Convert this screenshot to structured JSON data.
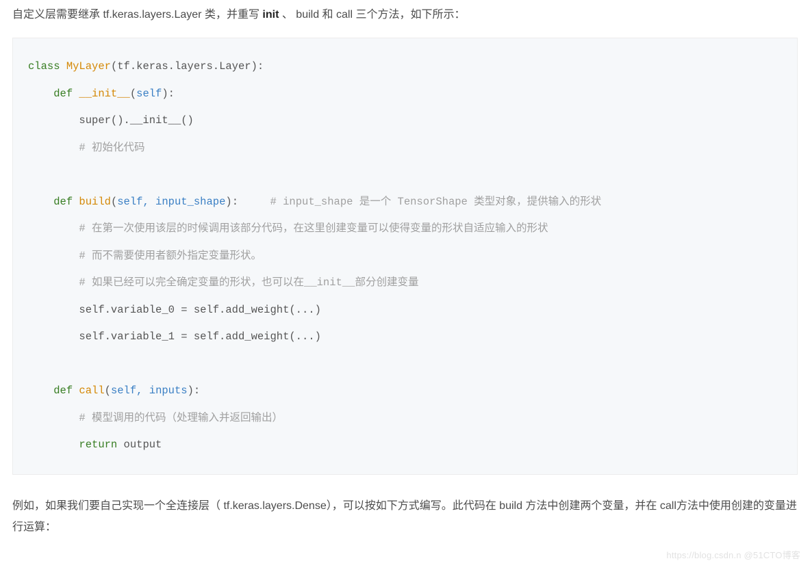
{
  "intro": {
    "t1": "自定义层需要继承 tf.keras.layers.Layer 类，并重写 ",
    "bold": "init",
    "t2": " 、 build 和 call 三个方法，如下所示："
  },
  "code": {
    "line01_kw": "class",
    "line01_name": " MyLayer",
    "line01_rest": "(tf.keras.layers.Layer):",
    "indent1": "    ",
    "line02_kw": "def",
    "line02_fn": " __init__",
    "line02_paren_open": "(",
    "line02_param": "self",
    "line02_close": "):",
    "indent2": "        ",
    "line03": "super().__init__()",
    "line04_cm": "# 初始化代码",
    "blank": "",
    "line05_kw": "def",
    "line05_fn": " build",
    "line05_paren_open": "(",
    "line05_params": "self, input_shape",
    "line05_close": "):",
    "line05_cm": "     # input_shape 是一个 TensorShape 类型对象，提供输入的形状",
    "line06_cm": "# 在第一次使用该层的时候调用该部分代码，在这里创建变量可以使得变量的形状自适应输入的形状",
    "line07_cm": "# 而不需要使用者额外指定变量形状。",
    "line08_cm": "# 如果已经可以完全确定变量的形状，也可以在__init__部分创建变量",
    "line09": "self.variable_0 = self.add_weight(...)",
    "line10": "self.variable_1 = self.add_weight(...)",
    "line11_kw": "def",
    "line11_fn": " call",
    "line11_paren_open": "(",
    "line11_params": "self, inputs",
    "line11_close": "):",
    "line12_cm": "# 模型调用的代码（处理输入并返回输出）",
    "line13_kw": "return",
    "line13_rest": " output"
  },
  "outro": "例如，如果我们要自己实现一个全连接层（ tf.keras.layers.Dense），可以按如下方式编写。此代码在 build 方法中创建两个变量，并在 call方法中使用创建的变量进行运算：",
  "watermark": "https://blog.csdn.n  @51CTO博客"
}
